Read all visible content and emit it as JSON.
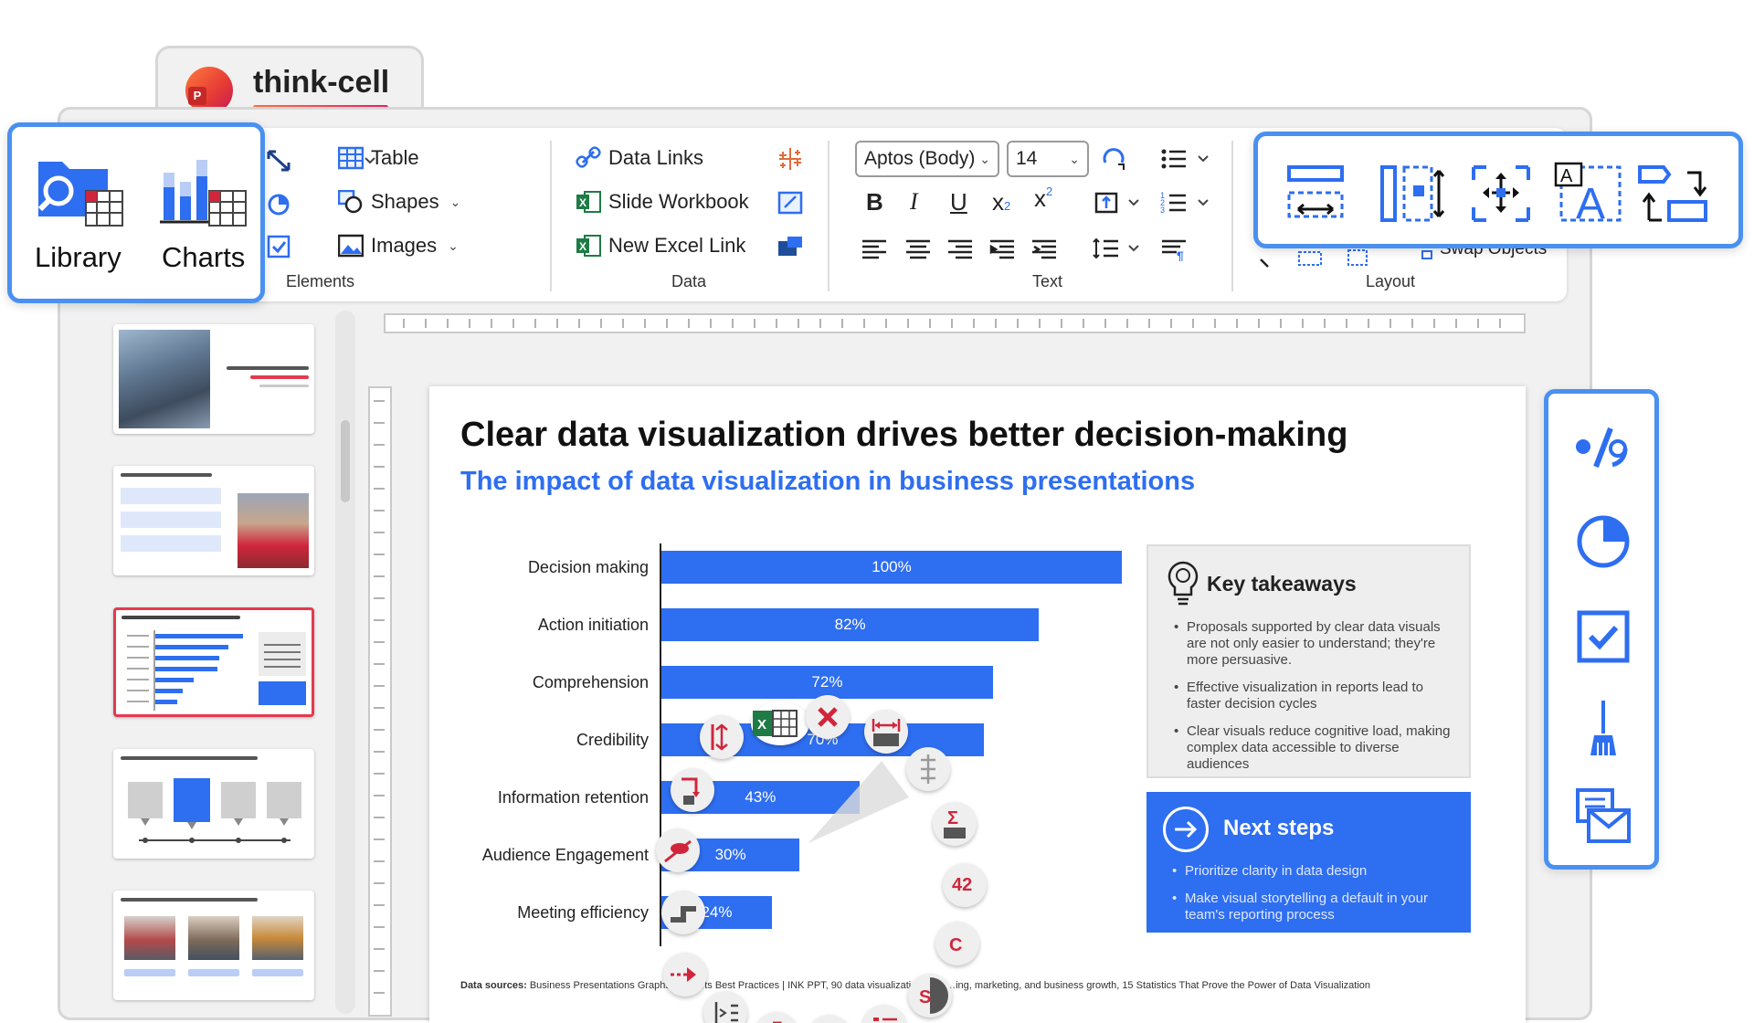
{
  "app": {
    "name": "think-cell"
  },
  "popup_left": {
    "library": "Library",
    "charts": "Charts"
  },
  "ribbon": {
    "groups": {
      "elements": "Elements",
      "data": "Data",
      "text": "Text",
      "layout": "Layout"
    },
    "elements": {
      "table": "Table",
      "shapes": "Shapes",
      "images": "Images"
    },
    "data": {
      "data_links": "Data Links",
      "slide_workbook": "Slide Workbook",
      "new_excel_link": "New Excel Link"
    },
    "text": {
      "font": "Aptos (Body)",
      "size": "14"
    },
    "layout": {
      "swap_objects": "Swap Objects"
    }
  },
  "slide": {
    "title": "Clear data visualization drives better decision-making",
    "subtitle": "The impact of data visualization in business presentations",
    "takeaways": {
      "title": "Key takeaways",
      "items": [
        "Proposals supported by clear data visuals are not only easier to understand; they're more persuasive.",
        "Effective visualization in reports lead to faster decision cycles",
        "Clear visuals reduce cognitive load, making complex data accessible to diverse audiences"
      ]
    },
    "next_steps": {
      "title": "Next steps",
      "items": [
        "Prioritize clarity in data design",
        "Make visual storytelling a default in your team's reporting process"
      ]
    },
    "sources_label": "Data sources:",
    "sources_text": "Business Presentations Graphs & Charts Best Practices | INK PPT, 90 data visualization st… …ing, marketing, and business growth, 15 Statistics That Prove the Power of Data Visualization"
  },
  "chart_data": {
    "type": "bar",
    "orientation": "horizontal",
    "categories": [
      "Decision making",
      "Action initiation",
      "Comprehension",
      "Credibility",
      "Information retention",
      "Audience Engagement",
      "Meeting efficiency"
    ],
    "values": [
      100,
      82,
      72,
      70,
      43,
      30,
      24
    ],
    "labels": [
      "100%",
      "82%",
      "72%",
      "70%",
      "43%",
      "30%",
      "24%"
    ],
    "color": "#2e6ef0",
    "xlim": [
      0,
      100
    ]
  },
  "colors": {
    "accent": "#2e6ef0",
    "popup_border": "#4a90f0",
    "active_slide": "#e53950",
    "icon_red": "#d0263c"
  }
}
